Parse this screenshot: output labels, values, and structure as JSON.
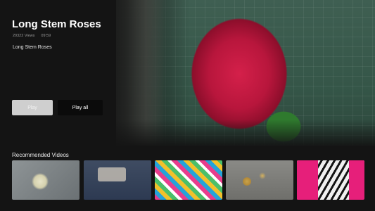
{
  "video": {
    "title": "Long Stem Roses",
    "views": "20322 Views",
    "duration": "09:59",
    "description": "Long Stem Roses"
  },
  "actions": {
    "play_label": "Play",
    "play_all_label": "Play all"
  },
  "recommended": {
    "heading": "Recommended Videos",
    "thumbnails": [
      {
        "icon": "flower-thumbnail"
      },
      {
        "icon": "hands-thumbnail"
      },
      {
        "icon": "woven-bag-thumbnail"
      },
      {
        "icon": "gold-flowers-thumbnail"
      },
      {
        "icon": "pink-zebra-thumbnail"
      }
    ]
  },
  "colors": {
    "background": "#141414",
    "play_button": "#cfcfcf",
    "play_all_button": "#0b0b0b"
  }
}
